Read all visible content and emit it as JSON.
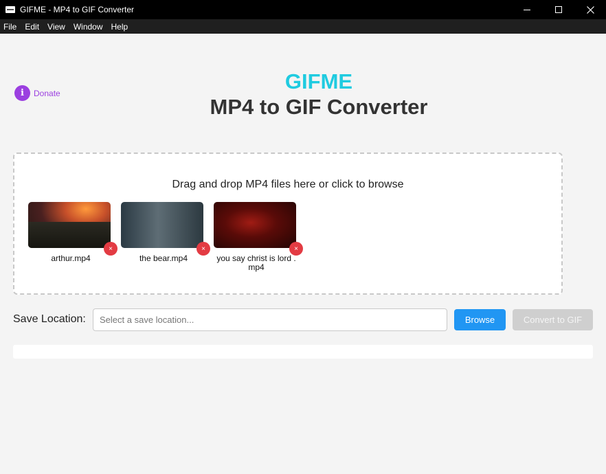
{
  "window": {
    "title": "GIFME - MP4 to GIF Converter"
  },
  "menu": {
    "items": [
      "File",
      "Edit",
      "View",
      "Window",
      "Help"
    ]
  },
  "donate": {
    "label": "Donate",
    "icon": "info-icon"
  },
  "header": {
    "brand": "GIFME",
    "title": "MP4 to GIF Converter"
  },
  "dropzone": {
    "instruction": "Drag and drop MP4 files here or click to browse",
    "files": [
      {
        "name": "arthur.mp4",
        "remove_symbol": "×"
      },
      {
        "name": "the bear.mp4",
        "remove_symbol": "×"
      },
      {
        "name": "you say christ is lord . mp4",
        "remove_symbol": "×"
      }
    ]
  },
  "save": {
    "label": "Save Location:",
    "placeholder": "Select a save location...",
    "value": "",
    "browse_label": "Browse",
    "convert_label": "Convert to GIF"
  },
  "progress": {
    "value": 0
  },
  "colors": {
    "brand": "#1fcbe0",
    "accent_purple": "#9b3fe0",
    "browse_blue": "#2196f3",
    "remove_red": "#e33b43",
    "disabled_gray": "#cfcfcf"
  }
}
